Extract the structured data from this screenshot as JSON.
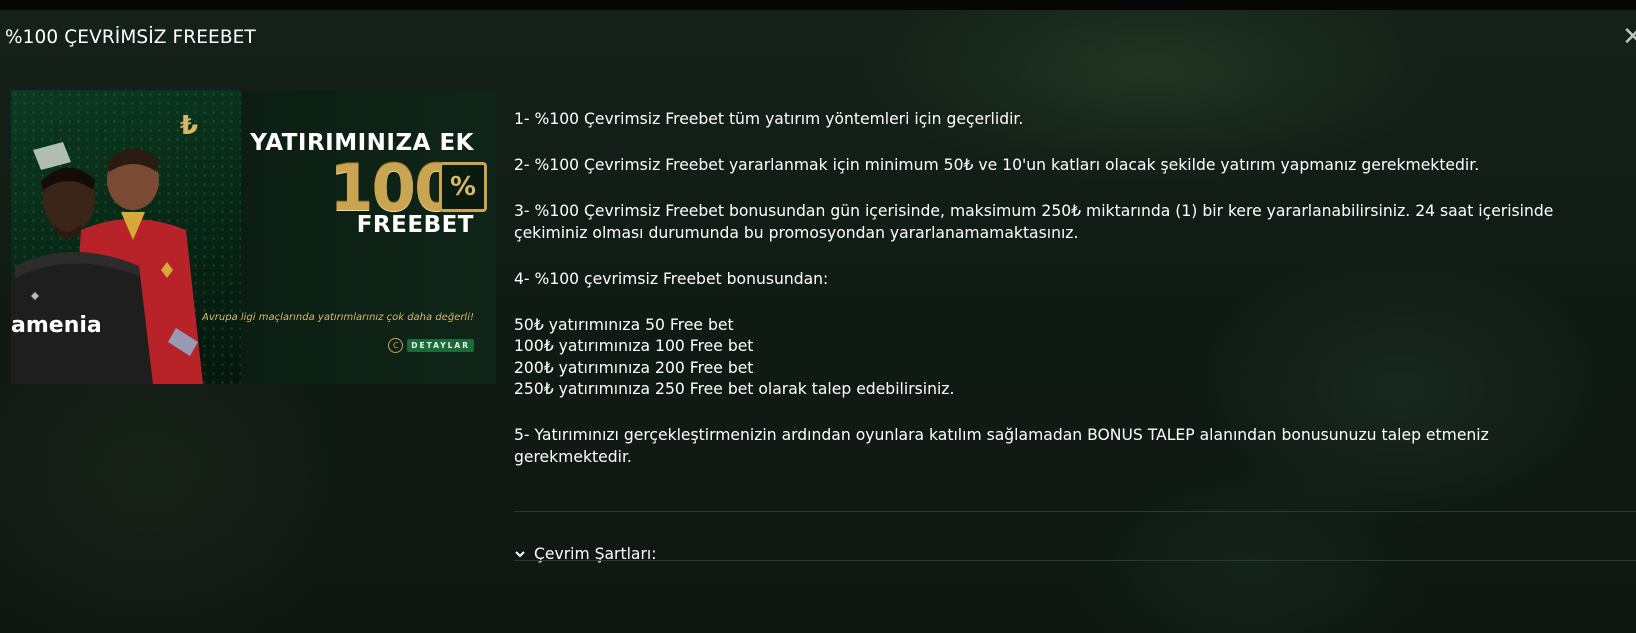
{
  "modal": {
    "title": "%100 ÇEVRİMSİZ FREEBET",
    "close_icon": "close-icon"
  },
  "banner": {
    "headline": "YATIRIMINIZA EK",
    "amount": "100",
    "percent_symbol": "%",
    "freebet_label": "FREEBET",
    "tagline": "Avrupa ligi maçlarında yatırımlarınız çok daha değerli!",
    "details_label": "DETAYLAR",
    "sponsor_text": "amenia",
    "colors": {
      "gold": "#c9a551",
      "green_bg": "#0c3a22"
    }
  },
  "rules": {
    "items": [
      "1- %100 Çevrimsiz Freebet tüm yatırım yöntemleri için geçerlidir.",
      "2- %100 Çevrimsiz Freebet yararlanmak için minimum 50₺ ve 10'un katları olacak şekilde yatırım yapmanız gerekmektedir.",
      "3- %100 Çevrimsiz Freebet bonusundan gün içerisinde, maksimum 250₺ miktarında (1) bir kere yararlanabilirsiniz. 24 saat içerisinde çekiminiz olması durumunda bu promosyondan yararlanamamaktasınız.",
      "4- %100 çevrimsiz Freebet bonusundan:"
    ],
    "amounts": [
      "50₺ yatırımınıza 50 Free bet",
      "100₺ yatırımınıza 100 Free bet",
      "200₺ yatırımınıza 200 Free bet",
      "250₺ yatırımınıza 250 Free bet olarak talep edebilirsiniz."
    ],
    "last": "5- Yatırımınızı gerçekleştirmenizin ardından oyunlara katılım sağlamadan BONUS TALEP alanından bonusunuzu talep etmeniz gerekmektedir."
  },
  "accordion": {
    "label": "Çevrim Şartları:",
    "icon": "chevron-down-icon",
    "expanded": false
  }
}
